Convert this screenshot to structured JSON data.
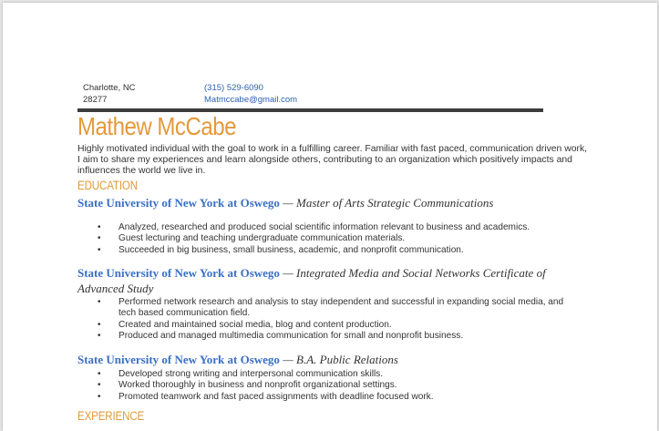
{
  "contact": {
    "city": "Charlotte, NC",
    "zip": "28277",
    "phone": "(315) 529-6090",
    "email": "Matmccabe@gmail.com"
  },
  "name": "Mathew McCabe",
  "summary": "Highly motivated individual with the goal to work in a fulfilling career. Familiar with fast paced, communication driven work, I aim to share my experiences and learn alongside others, contributing to an organization which positively impacts and influences the world we live in.",
  "sections": {
    "education": "EDUCATION",
    "experience": "EXPERIENCE"
  },
  "education": [
    {
      "institution": "State University of New York at Oswego",
      "degree": " — Master of Arts Strategic Communications",
      "bullets": [
        "Analyzed, researched and produced social scientific information relevant to business and academics.",
        "Guest lecturing and teaching undergraduate communication materials.",
        "Succeeded in big business, small business, academic, and nonprofit communication."
      ]
    },
    {
      "institution": "State University of New York at Oswego",
      "degree": " — Integrated Media and Social Networks Certificate of Advanced Study",
      "bullets": [
        "Performed network research and analysis to stay independent and successful in expanding social media, and tech based communication field.",
        "Created and maintained social media, blog and content production.",
        "Produced and managed multimedia communication for small and nonprofit business."
      ]
    },
    {
      "institution": "State University of New York at Oswego",
      "degree": " — B.A. Public Relations",
      "bullets": [
        "Developed strong writing and interpersonal communication skills.",
        "Worked thoroughly in business and nonprofit organizational settings.",
        "Promoted teamwork and fast paced assignments with deadline focused work."
      ]
    }
  ]
}
